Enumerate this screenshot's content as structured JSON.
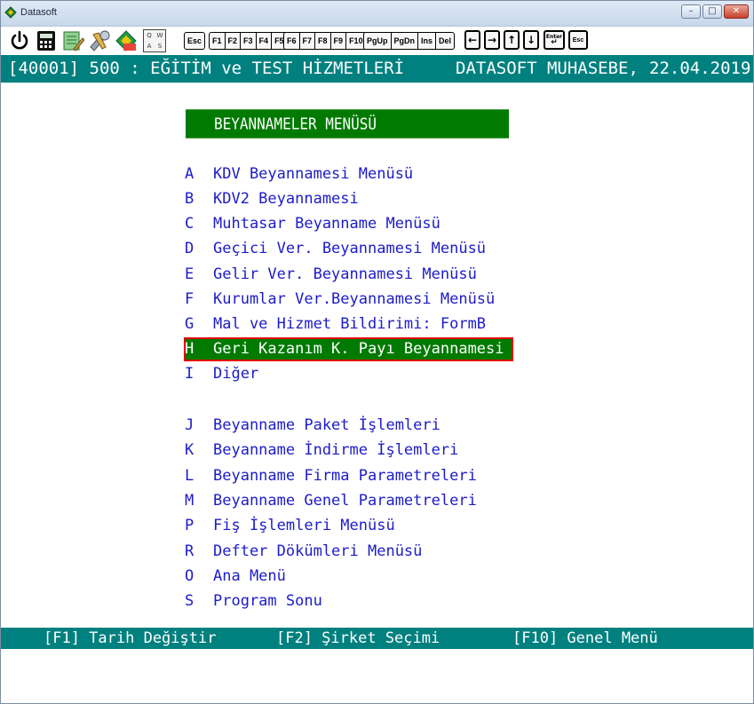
{
  "window": {
    "title": "Datasoft",
    "controls": {
      "minimize": "–",
      "maximize": "□",
      "close": "✕"
    }
  },
  "toolbar": {
    "icons": [
      "power-icon",
      "calculator-icon",
      "notepad-icon",
      "tools-icon",
      "user-settings-icon",
      "keyboard-layout-icon"
    ],
    "keyboard_badge": [
      "Q",
      "W",
      "A",
      "S"
    ],
    "keys_group1": [
      "Esc"
    ],
    "keys_group2": [
      "F1",
      "F2",
      "F3",
      "F4",
      "F5"
    ],
    "keys_group3": [
      "F6",
      "F7",
      "F8",
      "F9",
      "F10"
    ],
    "keys_group4": [
      "PgUp",
      "PgDn",
      "Ins",
      "Del"
    ],
    "arrow_keys": [
      "←",
      "→",
      "↑",
      "↓"
    ],
    "enter_key": "Enter",
    "esc_key": "Esc"
  },
  "header": {
    "company": "[40001] 500 : EĞİTİM ve TEST HİZMETLERİ",
    "product": "DATASOFT MUHASEBE,",
    "date": "22.04.2019"
  },
  "menu": {
    "title": "BEYANNAMELER MENÜSÜ",
    "items": [
      {
        "key": "A",
        "label": "KDV Beyannamesi Menüsü"
      },
      {
        "key": "B",
        "label": "KDV2 Beyannamesi"
      },
      {
        "key": "C",
        "label": "Muhtasar Beyanname Menüsü"
      },
      {
        "key": "D",
        "label": "Geçici Ver. Beyannamesi Menüsü"
      },
      {
        "key": "E",
        "label": "Gelir Ver. Beyannamesi Menüsü"
      },
      {
        "key": "F",
        "label": "Kurumlar Ver.Beyannamesi Menüsü"
      },
      {
        "key": "G",
        "label": "Mal ve Hizmet Bildirimi: FormB"
      },
      {
        "key": "H",
        "label": "Geri Kazanım K. Payı Beyannamesi"
      },
      {
        "key": "I",
        "label": "Diğer"
      },
      {
        "key": "J",
        "label": "Beyanname Paket İşlemleri"
      },
      {
        "key": "K",
        "label": "Beyanname İndirme İşlemleri"
      },
      {
        "key": "L",
        "label": "Beyanname Firma Parametreleri"
      },
      {
        "key": "M",
        "label": "Beyanname Genel Parametreleri"
      },
      {
        "key": "P",
        "label": "Fiş İşlemleri Menüsü"
      },
      {
        "key": "R",
        "label": "Defter Dökümleri Menüsü"
      },
      {
        "key": "O",
        "label": "Ana Menü"
      },
      {
        "key": "S",
        "label": "Program Sonu"
      }
    ],
    "selected_key": "H"
  },
  "footer": {
    "f1": "[F1] Tarih Değiştir",
    "f2": "[F2] Şirket Seçimi",
    "f10": "[F10] Genel Menü"
  },
  "colors": {
    "teal_bar": "#00807f",
    "menu_green": "#007a00",
    "menu_text_blue": "#1c1cc8",
    "highlight_border": "#e00000"
  }
}
